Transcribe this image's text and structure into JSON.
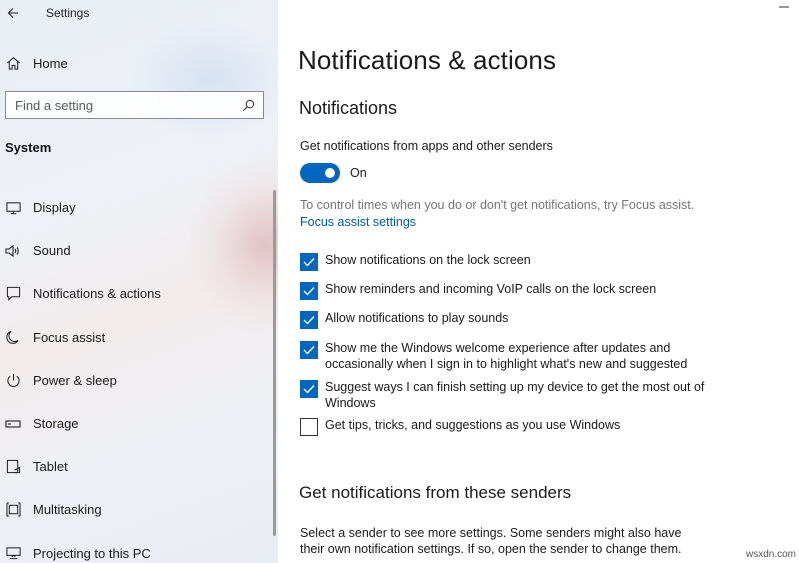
{
  "app": {
    "title": "Settings"
  },
  "sidebar": {
    "home_label": "Home",
    "search_placeholder": "Find a setting",
    "section": "System",
    "items": [
      {
        "label": "Display",
        "icon": "monitor-icon"
      },
      {
        "label": "Sound",
        "icon": "speaker-icon"
      },
      {
        "label": "Notifications & actions",
        "icon": "notification-icon"
      },
      {
        "label": "Focus assist",
        "icon": "moon-icon"
      },
      {
        "label": "Power & sleep",
        "icon": "power-icon"
      },
      {
        "label": "Storage",
        "icon": "storage-icon"
      },
      {
        "label": "Tablet",
        "icon": "tablet-icon"
      },
      {
        "label": "Multitasking",
        "icon": "multitasking-icon"
      },
      {
        "label": "Projecting to this PC",
        "icon": "projector-icon"
      }
    ]
  },
  "main": {
    "title": "Notifications & actions",
    "subtitle": "Notifications",
    "toggle_caption": "Get notifications from apps and other senders",
    "toggle_state": "On",
    "focus_hint": "To control times when you do or don't get notifications, try Focus assist.",
    "focus_link": "Focus assist settings",
    "checkboxes": [
      {
        "label": "Show notifications on the lock screen",
        "checked": true
      },
      {
        "label": "Show reminders and incoming VoIP calls on the lock screen",
        "checked": true
      },
      {
        "label": "Allow notifications to play sounds",
        "checked": true
      },
      {
        "label": "Show me the Windows welcome experience after updates and occasionally when I sign in to highlight what's new and suggested",
        "checked": true
      },
      {
        "label": "Suggest ways I can finish setting up my device to get the most out of Windows",
        "checked": true
      },
      {
        "label": "Get tips, tricks, and suggestions as you use Windows",
        "checked": false
      }
    ],
    "senders_title": "Get notifications from these senders",
    "senders_desc": "Select a sender to see more settings. Some senders might also have their own notification settings. If so, open the sender to change them."
  },
  "watermark": "wsxdn.com",
  "colors": {
    "accent": "#0067c0",
    "link": "#005a9e",
    "hint": "#767676"
  }
}
